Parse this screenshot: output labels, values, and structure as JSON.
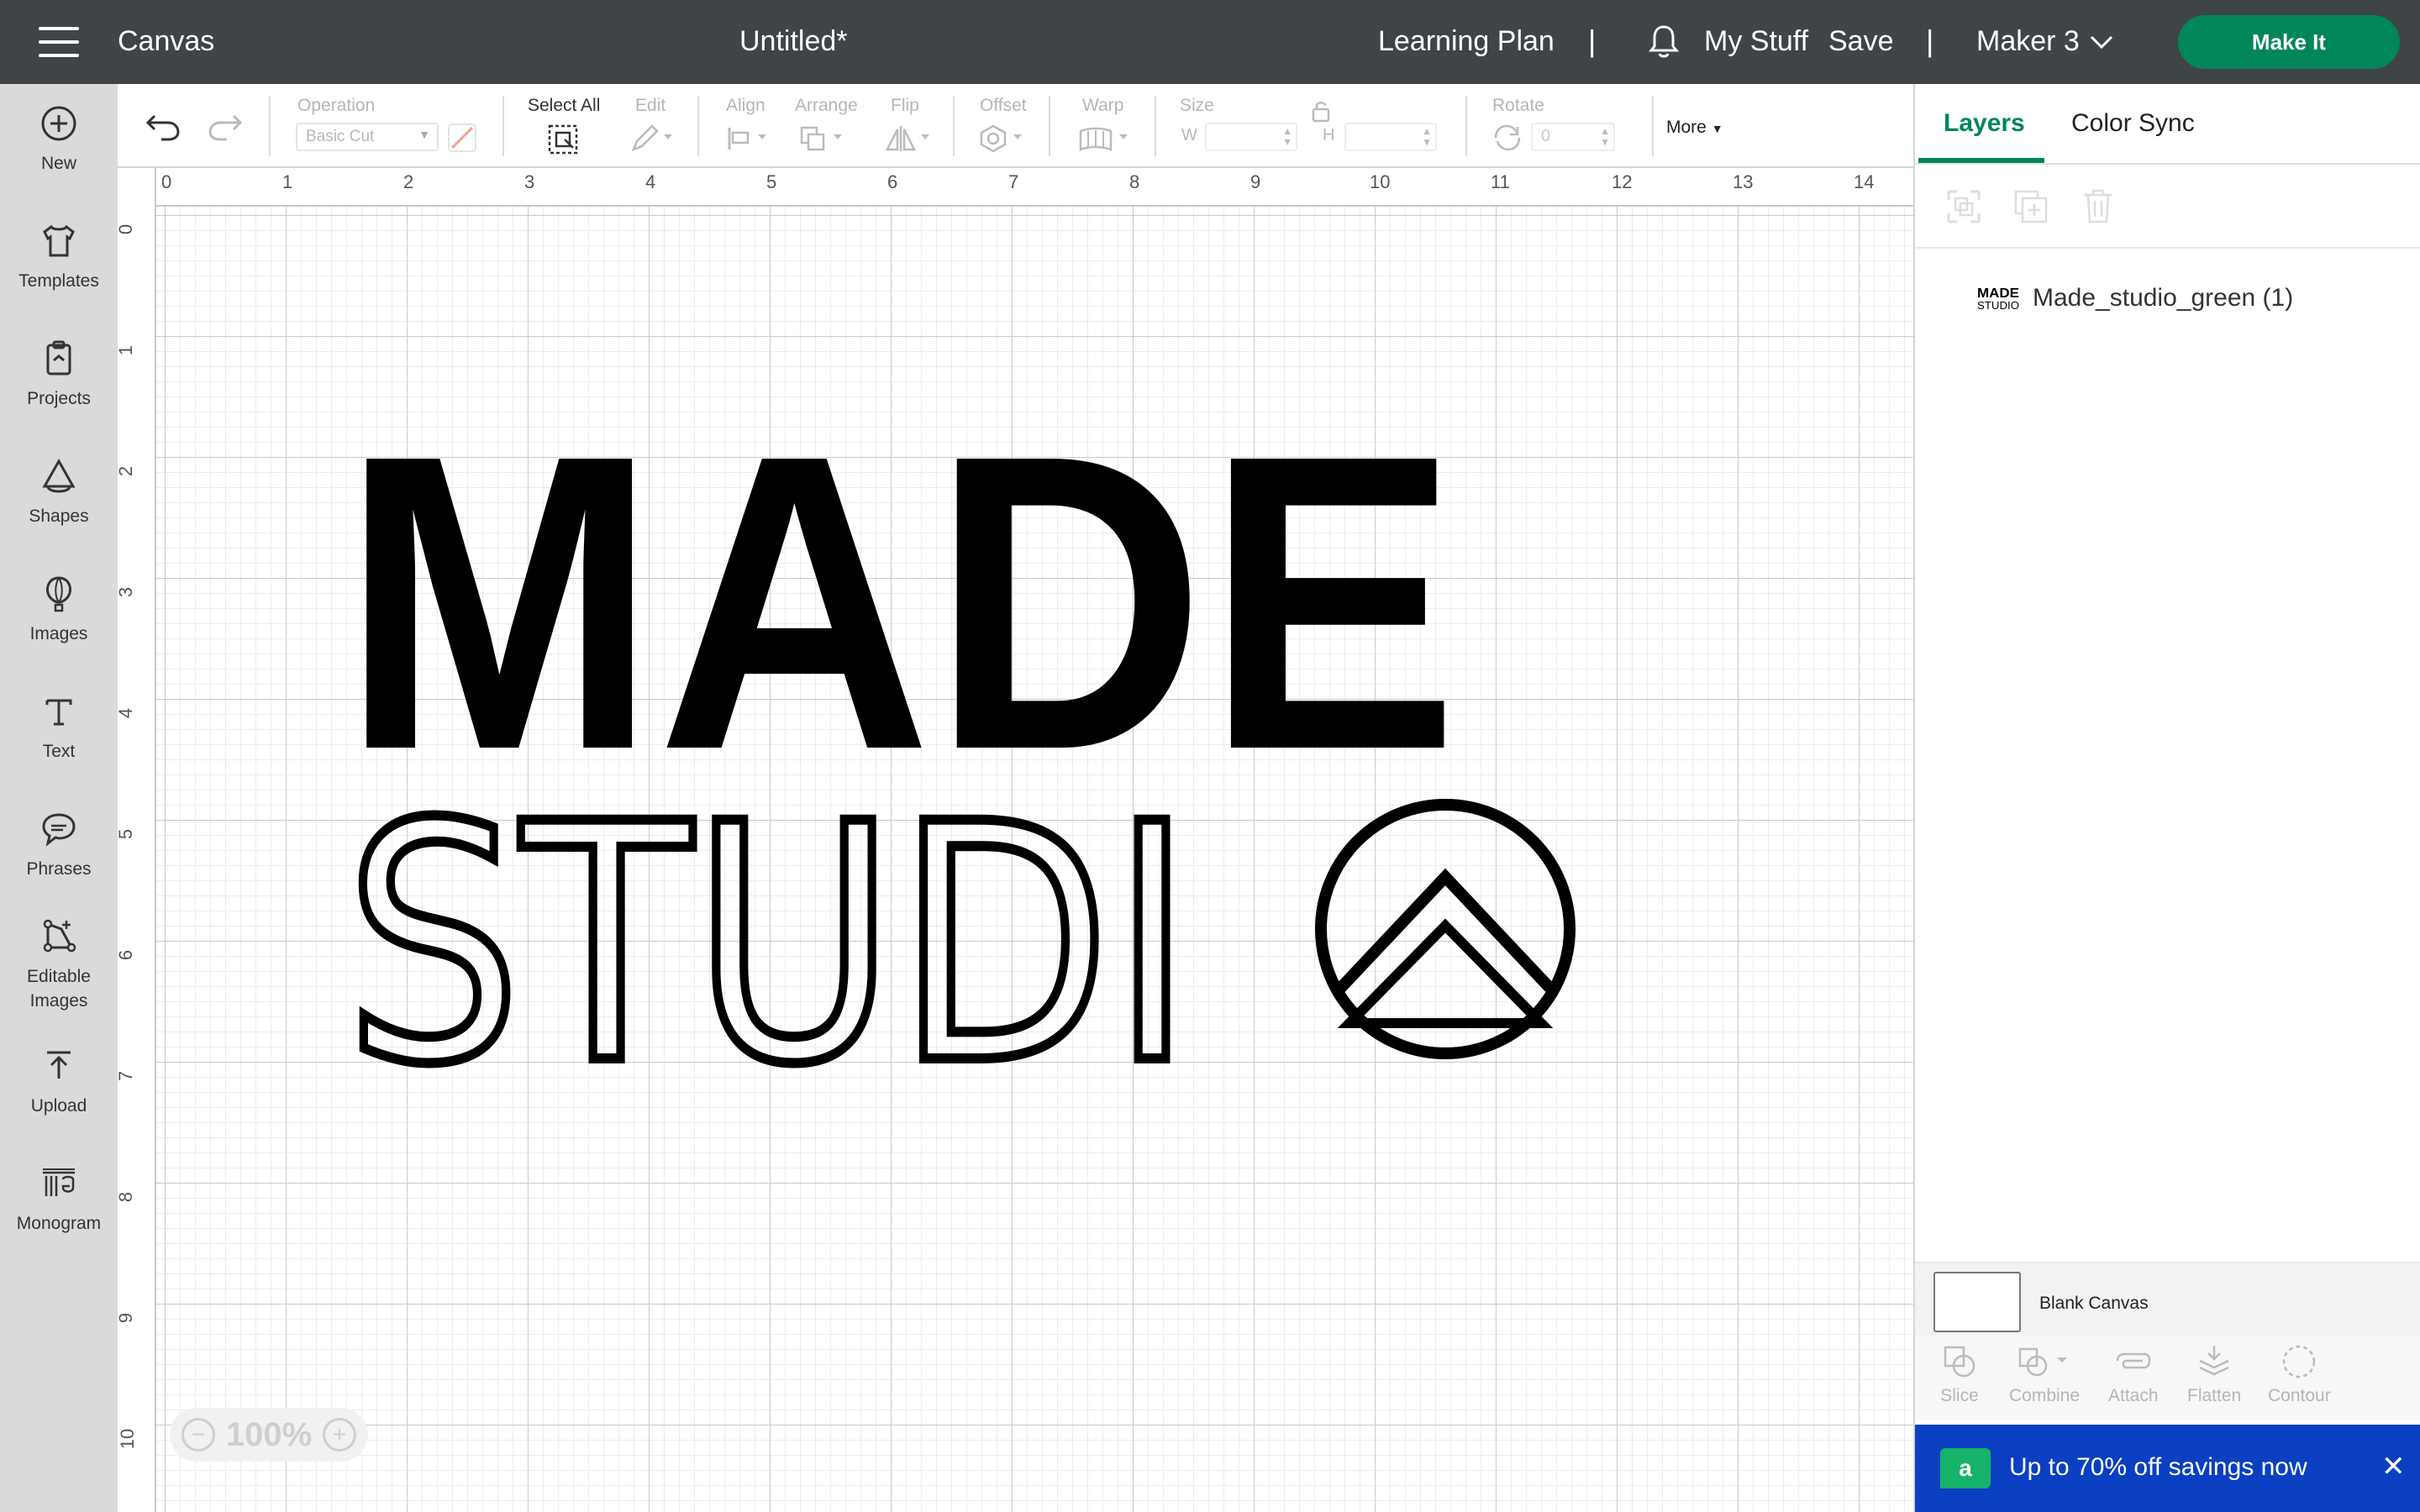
{
  "header": {
    "app_title": "Canvas",
    "doc_title": "Untitled*",
    "learning_plan": "Learning Plan",
    "separator": "|",
    "my_stuff": "My Stuff",
    "save": "Save",
    "machine": "Maker 3",
    "make_it": "Make It"
  },
  "sidebar": {
    "items": [
      {
        "label": "New",
        "icon": "plus-circle-icon"
      },
      {
        "label": "Templates",
        "icon": "shirt-icon"
      },
      {
        "label": "Projects",
        "icon": "clipboard-icon"
      },
      {
        "label": "Shapes",
        "icon": "shapes-icon"
      },
      {
        "label": "Images",
        "icon": "balloon-icon"
      },
      {
        "label": "Text",
        "icon": "text-t-icon"
      },
      {
        "label": "Phrases",
        "icon": "speech-bubble-icon"
      },
      {
        "label": "Editable Images",
        "icon": "editable-image-icon"
      },
      {
        "label": "Upload",
        "icon": "upload-arrow-icon"
      },
      {
        "label": "Monogram",
        "icon": "monogram-icon"
      }
    ]
  },
  "toolbar": {
    "operation_label": "Operation",
    "operation_value": "Basic Cut",
    "select_all": "Select All",
    "edit": "Edit",
    "align": "Align",
    "arrange": "Arrange",
    "flip": "Flip",
    "offset": "Offset",
    "warp": "Warp",
    "size": "Size",
    "w": "W",
    "h": "H",
    "rotate": "Rotate",
    "rotate_value": "0",
    "more": "More"
  },
  "canvas": {
    "ruler_top": [
      "0",
      "1",
      "2",
      "3",
      "4",
      "5",
      "6",
      "7",
      "8",
      "9",
      "10",
      "11",
      "12",
      "13",
      "14"
    ],
    "ruler_left": [
      "0",
      "1",
      "2",
      "3",
      "4",
      "5",
      "6",
      "7",
      "8",
      "9",
      "10"
    ],
    "zoom": "100%",
    "zoom_minus": "−",
    "zoom_plus": "+",
    "logo_word_top": "MADE",
    "logo_word_bottom": "STUDI"
  },
  "panel": {
    "tab_layers": "Layers",
    "tab_color_sync": "Color Sync",
    "layer_name": "Made_studio_green (1)",
    "layer_thumb_top": "MADE",
    "layer_thumb_bottom": "STUDIO",
    "blank_canvas": "Blank Canvas",
    "tools": {
      "slice": "Slice",
      "combine": "Combine",
      "attach": "Attach",
      "flatten": "Flatten",
      "contour": "Contour"
    },
    "promo_badge": "a",
    "promo_text": "Up to 70% off savings now",
    "promo_close": "✕"
  },
  "colors": {
    "header_bg": "#3f4446",
    "accent": "#008659",
    "sidebar_bg": "#dadada",
    "promo_bg": "#0a3fc1"
  }
}
